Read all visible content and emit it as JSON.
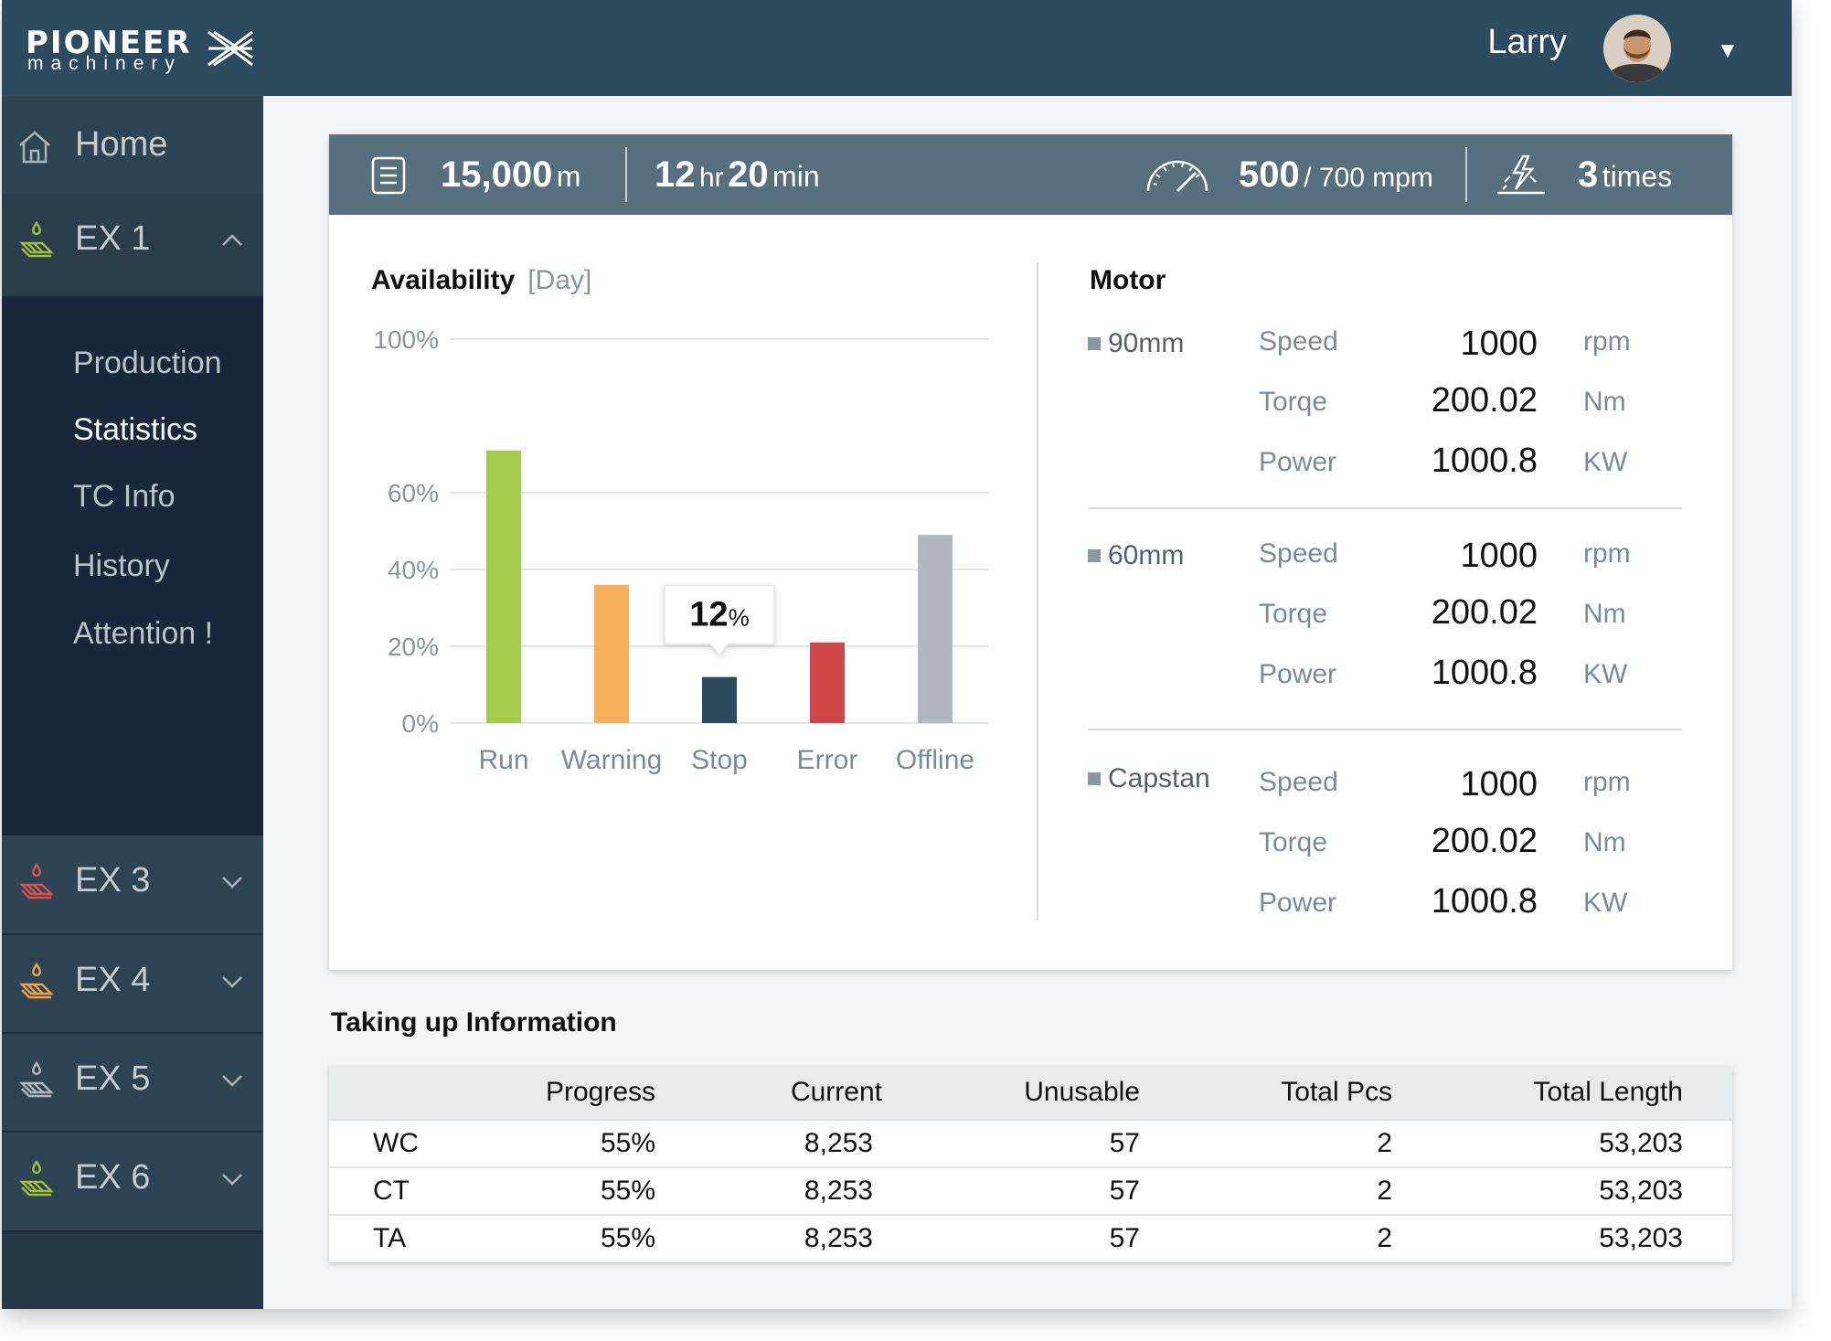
{
  "brand": {
    "name": "PIONEER",
    "sub": "machinery"
  },
  "user": {
    "name": "Larry"
  },
  "sidebar": {
    "home": "Home",
    "ex_groups": [
      {
        "label": "EX 1",
        "expanded": true,
        "icon_color": "#9dc03c"
      },
      {
        "label": "EX 3",
        "expanded": false,
        "icon_color": "#d9534f"
      },
      {
        "label": "EX 4",
        "expanded": false,
        "icon_color": "#f0a24a"
      },
      {
        "label": "EX 5",
        "expanded": false,
        "icon_color": "#b0b8bf"
      },
      {
        "label": "EX 6",
        "expanded": false,
        "icon_color": "#9dc03c"
      }
    ],
    "sub_items": [
      "Production",
      "Statistics",
      "TC Info",
      "History",
      "Attention !"
    ],
    "active_sub": "Statistics"
  },
  "stats": {
    "length_value": "15,000",
    "length_unit": "m",
    "hours_value": "12",
    "hours_unit": "hr",
    "minutes_value": "20",
    "minutes_unit": "min",
    "speed_value": "500",
    "speed_max": "/ 700 mpm",
    "times_value": "3",
    "times_unit": "times"
  },
  "availability": {
    "title": "Availability",
    "period": "[Day]",
    "tooltip_value": "12",
    "tooltip_unit": "%"
  },
  "chart_data": {
    "type": "bar",
    "title": "Availability",
    "categories": [
      "Run",
      "Warning",
      "Stop",
      "Error",
      "Offline"
    ],
    "values": [
      71,
      36,
      12,
      21,
      49
    ],
    "colors": [
      "#a4cc4c",
      "#f5ae5b",
      "#2d4b5e",
      "#ce4648",
      "#b0b7be"
    ],
    "yticks": [
      "0%",
      "20%",
      "40%",
      "60%",
      "100%"
    ],
    "grid": true,
    "highlighted": "Stop"
  },
  "motor": {
    "title": "Motor",
    "groups": [
      {
        "name": "90mm",
        "rows": [
          {
            "label": "Speed",
            "value": "1000",
            "unit": "rpm"
          },
          {
            "label": "Torqe",
            "value": "200.02",
            "unit": "Nm"
          },
          {
            "label": "Power",
            "value": "1000.8",
            "unit": "KW"
          }
        ]
      },
      {
        "name": "60mm",
        "rows": [
          {
            "label": "Speed",
            "value": "1000",
            "unit": "rpm"
          },
          {
            "label": "Torqe",
            "value": "200.02",
            "unit": "Nm"
          },
          {
            "label": "Power",
            "value": "1000.8",
            "unit": "KW"
          }
        ]
      },
      {
        "name": "Capstan",
        "rows": [
          {
            "label": "Speed",
            "value": "1000",
            "unit": "rpm"
          },
          {
            "label": "Torqe",
            "value": "200.02",
            "unit": "Nm"
          },
          {
            "label": "Power",
            "value": "1000.8",
            "unit": "KW"
          }
        ]
      }
    ]
  },
  "taking_up": {
    "title": "Taking up Information",
    "columns": [
      "Progress",
      "Current",
      "Unusable",
      "Total Pcs",
      "Total Length"
    ],
    "rows": [
      {
        "name": "WC",
        "cells": [
          "55%",
          "8,253",
          "57",
          "2",
          "53,203"
        ]
      },
      {
        "name": "CT",
        "cells": [
          "55%",
          "8,253",
          "57",
          "2",
          "53,203"
        ]
      },
      {
        "name": "TA",
        "cells": [
          "55%",
          "8,253",
          "57",
          "2",
          "53,203"
        ]
      }
    ]
  }
}
